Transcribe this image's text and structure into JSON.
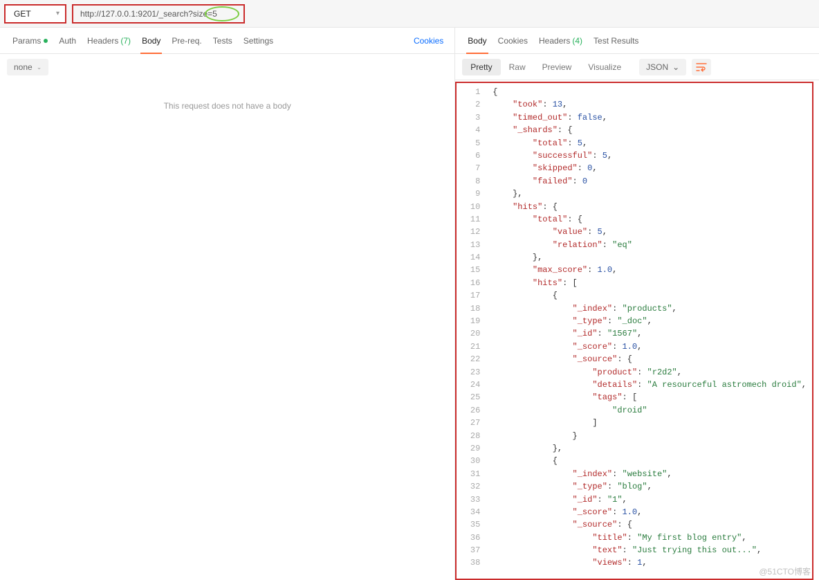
{
  "request": {
    "method": "GET",
    "url": "http://127.0.0.1:9201/_search?size=5"
  },
  "left_tabs": {
    "params": "Params",
    "auth": "Auth",
    "headers": "Headers",
    "headers_count": "(7)",
    "body": "Body",
    "prereq": "Pre-req.",
    "tests": "Tests",
    "settings": "Settings",
    "cookies_link": "Cookies"
  },
  "left_body": {
    "none": "none",
    "empty": "This request does not have a body"
  },
  "right_tabs": {
    "body": "Body",
    "cookies": "Cookies",
    "headers": "Headers",
    "headers_count": "(4)",
    "test_results": "Test Results"
  },
  "resp_toolbar": {
    "pretty": "Pretty",
    "raw": "Raw",
    "preview": "Preview",
    "visualize": "Visualize",
    "json": "JSON"
  },
  "response_json": {
    "took": 13,
    "timed_out": false,
    "_shards": {
      "total": 5,
      "successful": 5,
      "skipped": 0,
      "failed": 0
    },
    "hits": {
      "total": {
        "value": 5,
        "relation": "eq"
      },
      "max_score": 1.0,
      "hits": [
        {
          "_index": "products",
          "_type": "_doc",
          "_id": "1567",
          "_score": 1.0,
          "_source": {
            "product": "r2d2",
            "details": "A resourceful astromech droid",
            "tags": [
              "droid"
            ]
          }
        },
        {
          "_index": "website",
          "_type": "blog",
          "_id": "1",
          "_score": 1.0,
          "_source": {
            "title": "My first blog entry",
            "text": "Just trying this out...",
            "views": 1
          }
        }
      ]
    }
  },
  "code_lines": [
    [
      [
        "brace",
        "{"
      ]
    ],
    [
      [
        "sp",
        "    "
      ],
      [
        "key",
        "\"took\""
      ],
      [
        "brace",
        ": "
      ],
      [
        "num",
        "13"
      ],
      [
        "brace",
        ","
      ]
    ],
    [
      [
        "sp",
        "    "
      ],
      [
        "key",
        "\"timed_out\""
      ],
      [
        "brace",
        ": "
      ],
      [
        "bool",
        "false"
      ],
      [
        "brace",
        ","
      ]
    ],
    [
      [
        "sp",
        "    "
      ],
      [
        "key",
        "\"_shards\""
      ],
      [
        "brace",
        ": {"
      ]
    ],
    [
      [
        "sp",
        "        "
      ],
      [
        "key",
        "\"total\""
      ],
      [
        "brace",
        ": "
      ],
      [
        "num",
        "5"
      ],
      [
        "brace",
        ","
      ]
    ],
    [
      [
        "sp",
        "        "
      ],
      [
        "key",
        "\"successful\""
      ],
      [
        "brace",
        ": "
      ],
      [
        "num",
        "5"
      ],
      [
        "brace",
        ","
      ]
    ],
    [
      [
        "sp",
        "        "
      ],
      [
        "key",
        "\"skipped\""
      ],
      [
        "brace",
        ": "
      ],
      [
        "num",
        "0"
      ],
      [
        "brace",
        ","
      ]
    ],
    [
      [
        "sp",
        "        "
      ],
      [
        "key",
        "\"failed\""
      ],
      [
        "brace",
        ": "
      ],
      [
        "num",
        "0"
      ]
    ],
    [
      [
        "sp",
        "    "
      ],
      [
        "brace",
        "},"
      ]
    ],
    [
      [
        "sp",
        "    "
      ],
      [
        "key",
        "\"hits\""
      ],
      [
        "brace",
        ": {"
      ]
    ],
    [
      [
        "sp",
        "        "
      ],
      [
        "key",
        "\"total\""
      ],
      [
        "brace",
        ": {"
      ]
    ],
    [
      [
        "sp",
        "            "
      ],
      [
        "key",
        "\"value\""
      ],
      [
        "brace",
        ": "
      ],
      [
        "num",
        "5"
      ],
      [
        "brace",
        ","
      ]
    ],
    [
      [
        "sp",
        "            "
      ],
      [
        "key",
        "\"relation\""
      ],
      [
        "brace",
        ": "
      ],
      [
        "str",
        "\"eq\""
      ]
    ],
    [
      [
        "sp",
        "        "
      ],
      [
        "brace",
        "},"
      ]
    ],
    [
      [
        "sp",
        "        "
      ],
      [
        "key",
        "\"max_score\""
      ],
      [
        "brace",
        ": "
      ],
      [
        "num",
        "1.0"
      ],
      [
        "brace",
        ","
      ]
    ],
    [
      [
        "sp",
        "        "
      ],
      [
        "key",
        "\"hits\""
      ],
      [
        "brace",
        ": ["
      ]
    ],
    [
      [
        "sp",
        "            "
      ],
      [
        "brace",
        "{"
      ]
    ],
    [
      [
        "sp",
        "                "
      ],
      [
        "key",
        "\"_index\""
      ],
      [
        "brace",
        ": "
      ],
      [
        "str",
        "\"products\""
      ],
      [
        "brace",
        ","
      ]
    ],
    [
      [
        "sp",
        "                "
      ],
      [
        "key",
        "\"_type\""
      ],
      [
        "brace",
        ": "
      ],
      [
        "str",
        "\"_doc\""
      ],
      [
        "brace",
        ","
      ]
    ],
    [
      [
        "sp",
        "                "
      ],
      [
        "key",
        "\"_id\""
      ],
      [
        "brace",
        ": "
      ],
      [
        "str",
        "\"1567\""
      ],
      [
        "brace",
        ","
      ]
    ],
    [
      [
        "sp",
        "                "
      ],
      [
        "key",
        "\"_score\""
      ],
      [
        "brace",
        ": "
      ],
      [
        "num",
        "1.0"
      ],
      [
        "brace",
        ","
      ]
    ],
    [
      [
        "sp",
        "                "
      ],
      [
        "key",
        "\"_source\""
      ],
      [
        "brace",
        ": {"
      ]
    ],
    [
      [
        "sp",
        "                    "
      ],
      [
        "key",
        "\"product\""
      ],
      [
        "brace",
        ": "
      ],
      [
        "str",
        "\"r2d2\""
      ],
      [
        "brace",
        ","
      ]
    ],
    [
      [
        "sp",
        "                    "
      ],
      [
        "key",
        "\"details\""
      ],
      [
        "brace",
        ": "
      ],
      [
        "str",
        "\"A resourceful astromech droid\""
      ],
      [
        "brace",
        ","
      ]
    ],
    [
      [
        "sp",
        "                    "
      ],
      [
        "key",
        "\"tags\""
      ],
      [
        "brace",
        ": ["
      ]
    ],
    [
      [
        "sp",
        "                        "
      ],
      [
        "str",
        "\"droid\""
      ]
    ],
    [
      [
        "sp",
        "                    "
      ],
      [
        "brace",
        "]"
      ]
    ],
    [
      [
        "sp",
        "                "
      ],
      [
        "brace",
        "}"
      ]
    ],
    [
      [
        "sp",
        "            "
      ],
      [
        "brace",
        "},"
      ]
    ],
    [
      [
        "sp",
        "            "
      ],
      [
        "brace",
        "{"
      ]
    ],
    [
      [
        "sp",
        "                "
      ],
      [
        "key",
        "\"_index\""
      ],
      [
        "brace",
        ": "
      ],
      [
        "str",
        "\"website\""
      ],
      [
        "brace",
        ","
      ]
    ],
    [
      [
        "sp",
        "                "
      ],
      [
        "key",
        "\"_type\""
      ],
      [
        "brace",
        ": "
      ],
      [
        "str",
        "\"blog\""
      ],
      [
        "brace",
        ","
      ]
    ],
    [
      [
        "sp",
        "                "
      ],
      [
        "key",
        "\"_id\""
      ],
      [
        "brace",
        ": "
      ],
      [
        "str",
        "\"1\""
      ],
      [
        "brace",
        ","
      ]
    ],
    [
      [
        "sp",
        "                "
      ],
      [
        "key",
        "\"_score\""
      ],
      [
        "brace",
        ": "
      ],
      [
        "num",
        "1.0"
      ],
      [
        "brace",
        ","
      ]
    ],
    [
      [
        "sp",
        "                "
      ],
      [
        "key",
        "\"_source\""
      ],
      [
        "brace",
        ": {"
      ]
    ],
    [
      [
        "sp",
        "                    "
      ],
      [
        "key",
        "\"title\""
      ],
      [
        "brace",
        ": "
      ],
      [
        "str",
        "\"My first blog entry\""
      ],
      [
        "brace",
        ","
      ]
    ],
    [
      [
        "sp",
        "                    "
      ],
      [
        "key",
        "\"text\""
      ],
      [
        "brace",
        ": "
      ],
      [
        "str",
        "\"Just trying this out...\""
      ],
      [
        "brace",
        ","
      ]
    ],
    [
      [
        "sp",
        "                    "
      ],
      [
        "key",
        "\"views\""
      ],
      [
        "brace",
        ": "
      ],
      [
        "num",
        "1"
      ],
      [
        "brace",
        ","
      ]
    ]
  ],
  "watermark": "@51CTO博客"
}
